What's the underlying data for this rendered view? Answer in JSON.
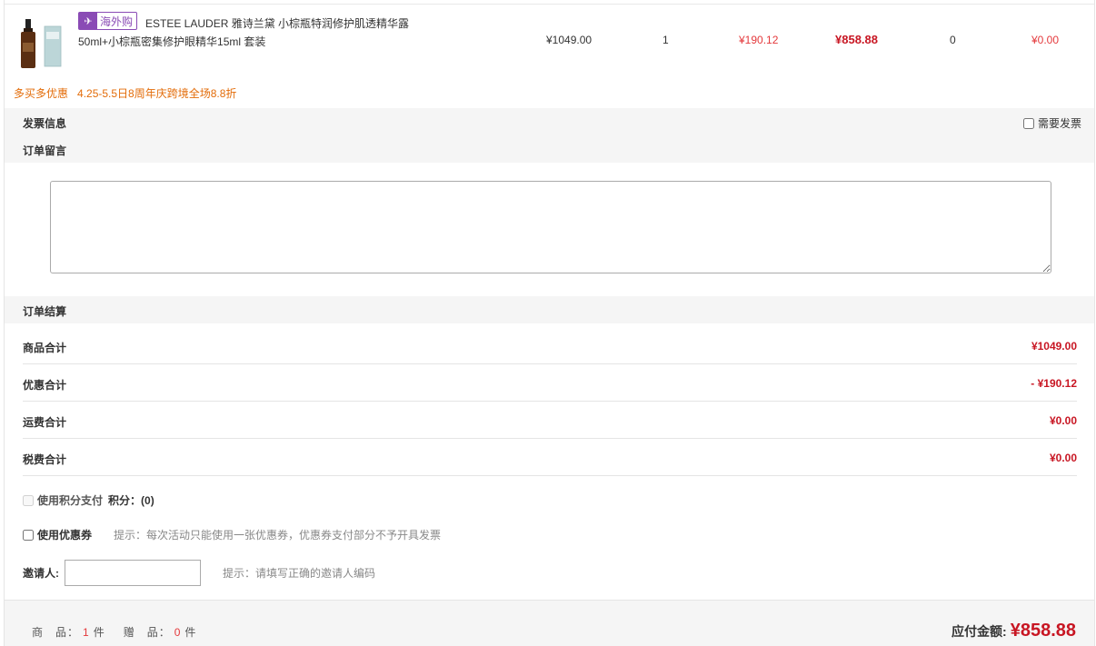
{
  "product": {
    "badge_label": "海外购",
    "name": "ESTEE LAUDER 雅诗兰黛 小棕瓶特润修护肌透精华露50ml+小棕瓶密集修护眼精华15ml 套装",
    "price": "¥1049.00",
    "quantity": "1",
    "discount": "¥190.12",
    "subtotal": "¥858.88",
    "tax_rate": "0",
    "tax_amount": "¥0.00"
  },
  "promotion": {
    "label": "多买多优惠",
    "text": "4.25-5.5日8周年庆跨境全场8.8折"
  },
  "invoice": {
    "title": "发票信息",
    "need_invoice_label": "需要发票"
  },
  "memo": {
    "title": "订单留言",
    "value": ""
  },
  "settlement": {
    "title": "订单结算",
    "rows": [
      {
        "label": "商品合计",
        "value": "¥1049.00"
      },
      {
        "label": "优惠合计",
        "value": "- ¥190.12"
      },
      {
        "label": "运费合计",
        "value": "¥0.00"
      },
      {
        "label": "税费合计",
        "value": "¥0.00"
      }
    ]
  },
  "points": {
    "label": "使用积分支付",
    "points_label": "积分：",
    "points_value": "(0)"
  },
  "coupon": {
    "label": "使用优惠券",
    "hint": "提示：每次活动只能使用一张优惠券，优惠券支付部分不予开具发票"
  },
  "inviter": {
    "label": "邀请人:",
    "value": "",
    "hint": "提示：请填写正确的邀请人编码"
  },
  "footer": {
    "goods_label": "商　品：",
    "goods_count": "1",
    "goods_unit": "件",
    "gift_label": "赠　品：",
    "gift_count": "0",
    "gift_unit": "件",
    "payable_label": "应付金额:",
    "payable_amount": "¥858.88"
  },
  "colors": {
    "price_red": "#c81623",
    "discount_red": "#e4393c",
    "promo_orange": "#e36c09",
    "badge_purple": "#8a4bb5"
  }
}
